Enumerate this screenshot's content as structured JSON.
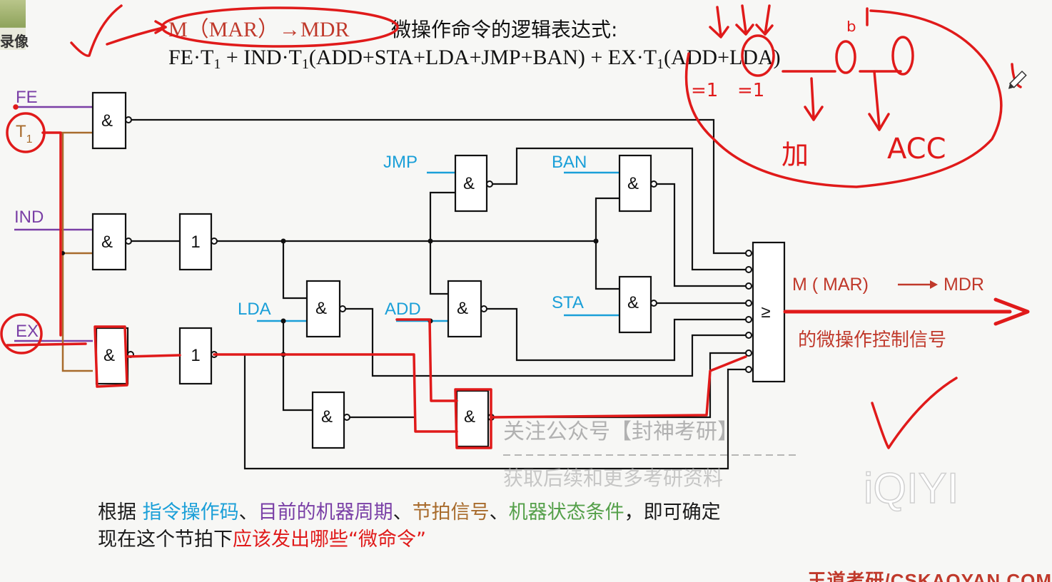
{
  "title": {
    "lhs": "M（MAR）→MDR",
    "rest": " 微操作命令的逻辑表达式:",
    "formula_parts": [
      "FE·T",
      "1",
      " + IND·T",
      "1",
      "(ADD+STA+LDA+JMP+BAN) + EX·T",
      "1",
      "(ADD+LDA)"
    ]
  },
  "signals": {
    "FE": "FE",
    "T1_main": "T",
    "T1_sub": "1",
    "IND": "IND",
    "EX": "EX",
    "JMP": "JMP",
    "BAN": "BAN",
    "LDA": "LDA",
    "ADD": "ADD",
    "STA": "STA"
  },
  "gates": {
    "and": "&",
    "not": "1",
    "or": "≥"
  },
  "output": {
    "label": "M ( MAR)",
    "target": "MDR",
    "desc": "的微操作控制信号"
  },
  "annotations": {
    "eq1a": "=1",
    "eq1b": "=1",
    "add_cn": "加",
    "acc": "ACC",
    "mark": "ᵇ"
  },
  "watermark": {
    "line1": "关注公众号【封神考研】",
    "line2": "获取后续和更多考研资料",
    "logo": "iQIYI"
  },
  "caption": {
    "p1": "根据 ",
    "opcode": "指令操作码",
    "sep1": "、",
    "cycle": "目前的机器周期",
    "sep2": "、",
    "beat": "节拍信号",
    "sep3": "、",
    "state": "机器状态条件",
    "p2": "，即可确定",
    "p3": "现在这个节拍下",
    "emit": "应该发出哪些“微命令”"
  },
  "corner": {
    "label": "录像"
  },
  "brand": "王道考研/CSKAOYAN.COM",
  "colors": {
    "purple": "#7a3fa6",
    "brown": "#a86b2c",
    "blue": "#1a9fd8",
    "red": "#e01a1a",
    "darkred": "#c0392b",
    "green": "#55a04a",
    "black": "#111111"
  }
}
